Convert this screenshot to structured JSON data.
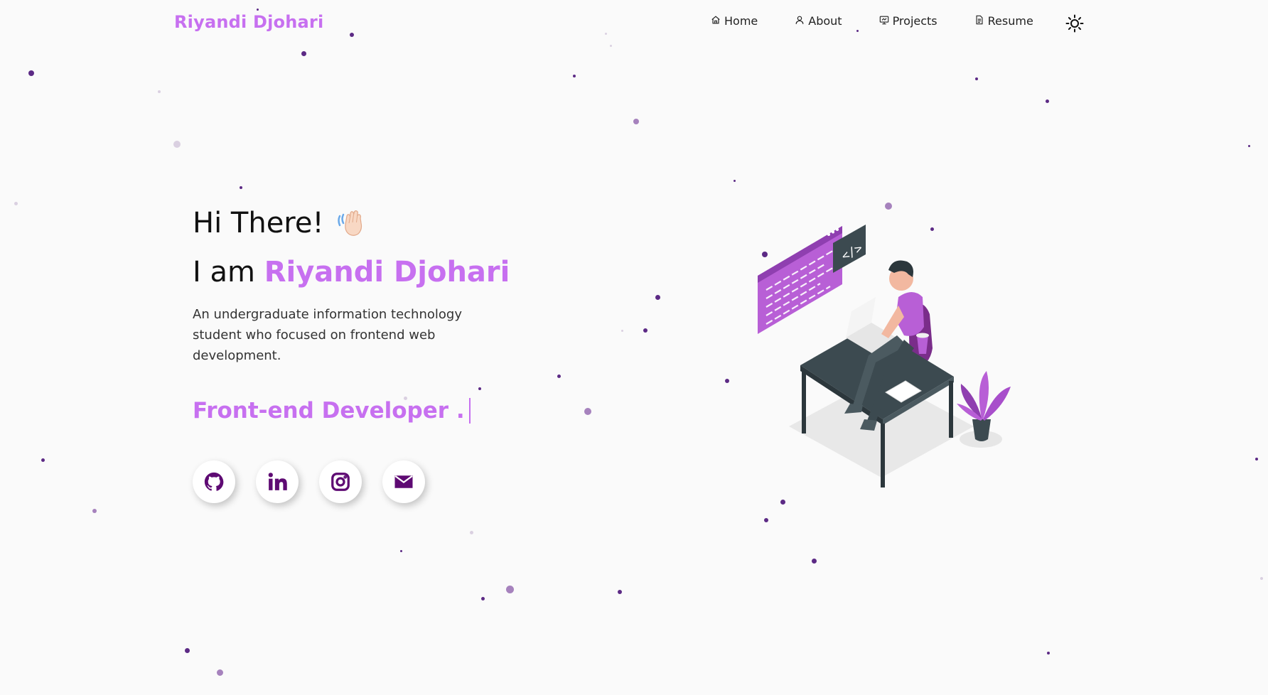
{
  "brand": "Riyandi Djohari",
  "nav": [
    {
      "label": "Home",
      "icon": "home-icon"
    },
    {
      "label": "About",
      "icon": "user-icon"
    },
    {
      "label": "Projects",
      "icon": "projects-icon"
    },
    {
      "label": "Resume",
      "icon": "document-icon"
    }
  ],
  "theme_toggle": {
    "icon": "sun-icon"
  },
  "hero": {
    "greeting": "Hi There!",
    "intro_prefix": "I am",
    "name": "Riyandi Djohari",
    "description": "An undergraduate information technology student who focused on frontend web development.",
    "typing_text": "Front-end Developer ."
  },
  "socials": [
    {
      "name": "github",
      "icon": "github-icon"
    },
    {
      "name": "linkedin",
      "icon": "linkedin-icon"
    },
    {
      "name": "instagram",
      "icon": "instagram-icon"
    },
    {
      "name": "email",
      "icon": "mail-icon"
    }
  ],
  "colors": {
    "accent": "#c770f0",
    "icon_purple": "#5e0a73",
    "background": "#fafafa",
    "particle": "#5c2a85"
  }
}
